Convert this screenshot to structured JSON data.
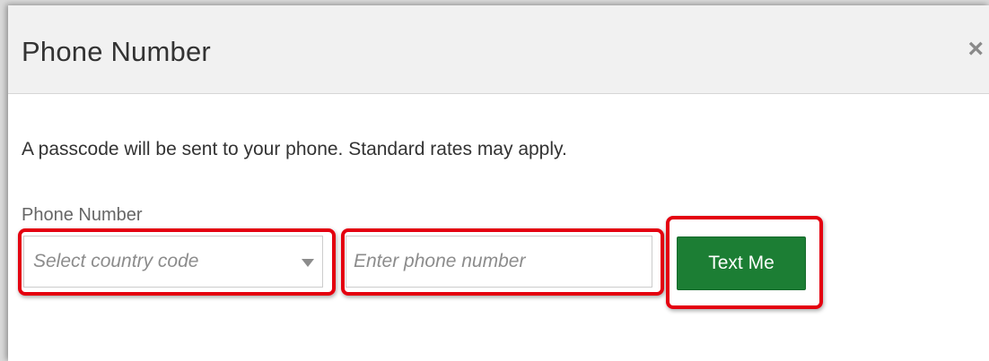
{
  "dialog": {
    "title": "Phone Number",
    "close_label": "×",
    "description": "A passcode will be sent to your phone. Standard rates may apply."
  },
  "form": {
    "field_label": "Phone Number",
    "country_select": {
      "placeholder": "Select country code",
      "value": ""
    },
    "phone_input": {
      "placeholder": "Enter phone number",
      "value": ""
    },
    "submit_label": "Text Me"
  },
  "colors": {
    "accent_button": "#1c7e34",
    "highlight": "#e4000f",
    "header_bg": "#f1f1f1"
  },
  "icons": {
    "close": "close-icon",
    "dropdown": "chevron-down-icon"
  }
}
